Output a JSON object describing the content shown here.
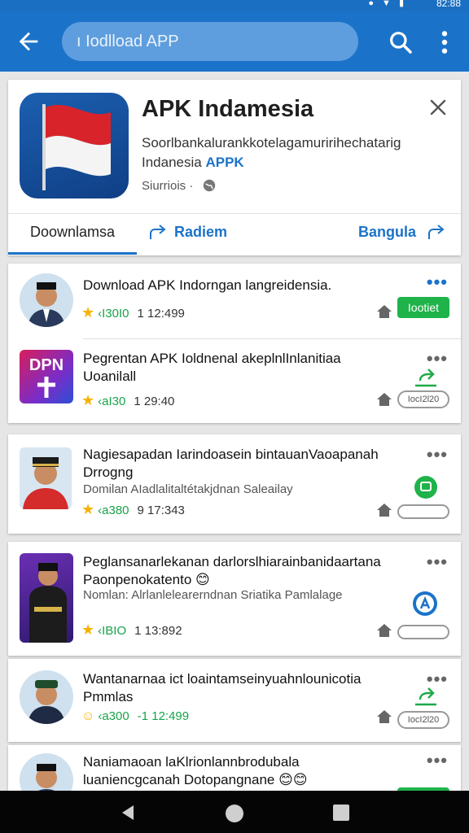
{
  "status": {
    "time": "82:88"
  },
  "search": {
    "value": "ı Iodlload APP"
  },
  "hero": {
    "title": "APK Indamesia",
    "desc_line1": "Soorlbankalurankkotelagamuririhechatarig",
    "desc_line2_prefix": "Indanesia ",
    "desc_line2_highlight": "APPK",
    "meta": "Siurriois ·",
    "tabs": [
      {
        "label": "Doownlamsa"
      },
      {
        "label": "Radiem"
      },
      {
        "label": "Bangula"
      }
    ]
  },
  "apps": [
    {
      "title": "Download APK Indorngan langreidensia.",
      "sub": "",
      "rating_value": "‹I30I0",
      "count": "1 12:499",
      "badge": "Iootiet"
    },
    {
      "title": "Pegrentan APK Ioldnenal akeplnlInlanitiaa Uoanilall",
      "sub": "",
      "avatar_text": "DPN",
      "rating_value": "‹aI30",
      "count": "1 29:40",
      "badge": "IocI2l20"
    },
    {
      "title": "Nagiesapadan Iarindoasein bintauanVaoapanah Drrogng",
      "sub": "Domilan AIadlalitaltétakjdnan Saleailay",
      "rating_value": "‹a380",
      "count": "9 17:343",
      "badge": ""
    },
    {
      "title": "Peglansanarlekanan darlorslhiarainbanidaartana Paonpenokatento 😊",
      "sub": "Nomlan: Alrlanlelearerndnan Sriatika Pamlalage",
      "rating_value": "‹IBIO",
      "count": "1 13:892",
      "badge": ""
    },
    {
      "title": "Wantanarnaa ict loaintamseinyuahnlounicotia Pmmlas",
      "sub": "",
      "rating_value": "‹a300",
      "count": "-1 12:499",
      "badge": "IocI2l20"
    },
    {
      "title": "Naniamaoan laKlrionlannbrodubala luaniencgcanah Dotopangnane 😊😊",
      "sub": "",
      "rating_value": "",
      "count": "",
      "badge": ""
    }
  ]
}
